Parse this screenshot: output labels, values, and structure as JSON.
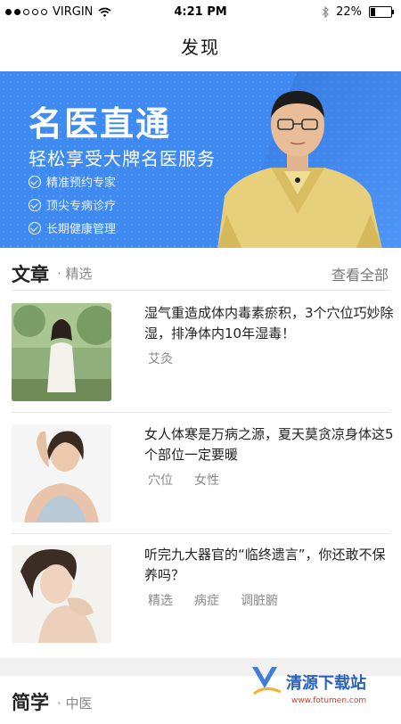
{
  "status_bar": {
    "carrier": "VIRGIN",
    "time": "4:21 PM",
    "battery": "22%",
    "battery_level": 0.22
  },
  "nav": {
    "title": "发现"
  },
  "banner": {
    "headline": "名医直通",
    "subtitle": "轻松享受大牌名医服务",
    "features": [
      "精准预约专家",
      "顶尖专病诊疗",
      "长期健康管理"
    ]
  },
  "articles_section": {
    "title": "文章",
    "subtitle": "精选",
    "more": "查看全部"
  },
  "articles": [
    {
      "title": "湿气重造成体内毒素瘀积，3个穴位巧妙除湿，排净体内10年湿毒！",
      "tags": [
        "艾灸"
      ]
    },
    {
      "title": "女人体寒是万病之源，夏天莫贪凉身体这5个部位一定要暖",
      "tags": [
        "穴位",
        "女性"
      ]
    },
    {
      "title": "听完九大器官的“临终遗言”，你还敢不保养吗？",
      "tags": [
        "精选",
        "病症",
        "调脏腑"
      ]
    }
  ],
  "next_section": {
    "title": "简学",
    "subtitle": "中医"
  },
  "watermark": {
    "text": "清源下载站",
    "url": "www.fotumen.com"
  }
}
